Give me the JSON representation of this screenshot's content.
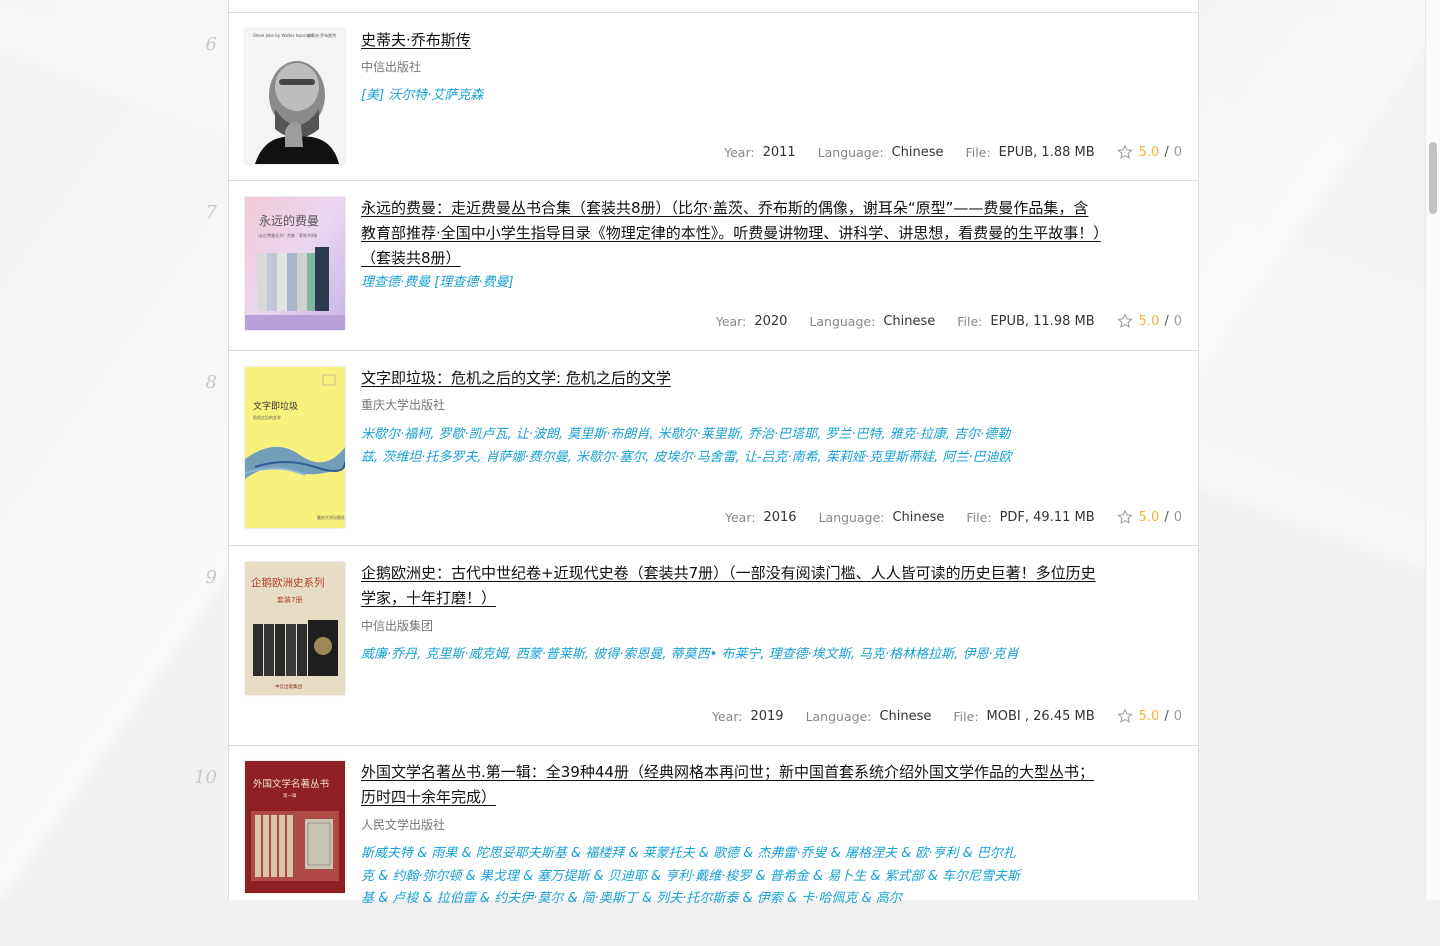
{
  "books": [
    {
      "index": "6",
      "title": "史蒂夫·乔布斯传",
      "publisher": "中信出版社",
      "authors": "[美] 沃尔特·艾萨克森",
      "year_label": "Year:",
      "year": "2011",
      "language_label": "Language:",
      "language": "Chinese",
      "file_label": "File:",
      "file": "EPUB, 1.88 MB",
      "rating": "5.0",
      "rating_sep": "/",
      "rating_count": "0",
      "cover_text": "Steve Jobs by Walter Isaacson  史蒂夫·乔布斯传"
    },
    {
      "index": "7",
      "title": "永远的费曼：走近费曼丛书合集（套装共8册）（比尔·盖茨、乔布斯的偶像，谢耳朵“原型”——费曼作品集，含教育部推荐·全国中小学生指导目录《物理定律的本性》。听费曼讲物理、讲科学、讲思想，看费曼的生平故事！）（套装共8册）",
      "publisher": "",
      "authors": "理查德·费曼 [理查德·费曼]",
      "year_label": "Year:",
      "year": "2020",
      "language_label": "Language:",
      "language": "Chinese",
      "file_label": "File:",
      "file": "EPUB, 11.98 MB",
      "rating": "5.0",
      "rating_sep": "/",
      "rating_count": "0",
      "cover_text": "永远的费曼"
    },
    {
      "index": "8",
      "title": "文字即垃圾：危机之后的文学: 危机之后的文学",
      "publisher": "重庆大学出版社",
      "authors": "米歇尔·福柯, 罗歇·凯卢瓦, 让·波朗, 莫里斯·布朗肖, 米歇尔·莱里斯, 乔治·巴塔耶, 罗兰·巴特, 雅克·拉康, 吉尔·德勒兹, 茨维坦·托多罗夫, 肖萨娜·费尔曼, 米歇尔·塞尔, 皮埃尔·马舍雷, 让-吕克·南希, 茱莉娅·克里斯蒂娃, 阿兰·巴迪欧",
      "year_label": "Year:",
      "year": "2016",
      "language_label": "Language:",
      "language": "Chinese",
      "file_label": "File:",
      "file": "PDF, 49.11 MB",
      "rating": "5.0",
      "rating_sep": "/",
      "rating_count": "0",
      "cover_text": "文字即垃圾"
    },
    {
      "index": "9",
      "title": "企鹅欧洲史：古代中世纪卷+近现代史卷（套装共7册）（一部没有阅读门槛、人人皆可读的历史巨著！多位历史学家，十年打磨！）",
      "publisher": "中信出版集团",
      "authors": "威廉·乔丹, 克里斯·威克姆, 西蒙·普莱斯, 彼得·索恩曼, 蒂莫西• 布莱宁, 理查德·埃文斯, 马克·格林格拉斯, 伊恩·克肖",
      "year_label": "Year:",
      "year": "2019",
      "language_label": "Language:",
      "language": "Chinese",
      "file_label": "File:",
      "file": "MOBI , 26.45 MB",
      "rating": "5.0",
      "rating_sep": "/",
      "rating_count": "0",
      "cover_text": "企鹅欧洲史系列 套装7册"
    },
    {
      "index": "10",
      "title": "外国文学名著丛书.第一辑：全39种44册（经典网格本再问世；新中国首套系统介绍外国文学作品的大型丛书；历时四十余年完成）",
      "publisher": "人民文学出版社",
      "authors": "斯威夫特 & 雨果 & 陀思妥耶夫斯基 & 福楼拜 & 莱蒙托夫 & 歌德 & 杰弗雷·乔叟 & 屠格涅夫 & 欧·亨利 & 巴尔扎克 & 约翰·弥尔顿 & 果戈理 & 塞万提斯 & 贝迪耶 & 亨利·戴维·梭罗 & 普希金 & 易卜生 & 紫式部 & 车尔尼雪夫斯基 & 卢梭 & 拉伯雷 & 约夫伊·莫尔 & 简·奥斯丁 & 列夫·托尔斯泰 & 伊索 & 卡·哈佩克 & 高尔",
      "cover_text": "外国文学名著丛书"
    }
  ]
}
